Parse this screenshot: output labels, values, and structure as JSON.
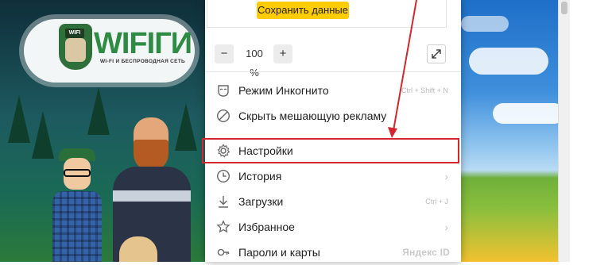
{
  "site_banner": {
    "logo_text": "WIFIГИ",
    "logo_badge": "WIFI",
    "logo_subtitle": "WI-FI И БЕСПРОВОДНАЯ СЕТЬ"
  },
  "menu": {
    "save_button_label": "Сохранить данные",
    "zoom": {
      "minus_label": "−",
      "value": "100 %",
      "plus_label": "+"
    },
    "items": [
      {
        "label": "Режим Инкогнито",
        "shortcut": "Ctrl + Shift + N",
        "icon": "incognito-mask-icon"
      },
      {
        "label": "Скрыть мешающую рекламу",
        "icon": "block-icon"
      },
      {
        "label": "Настройки",
        "icon": "gear-icon"
      },
      {
        "label": "История",
        "chevron": "›",
        "icon": "clock-icon"
      },
      {
        "label": "Загрузки",
        "shortcut": "Ctrl + J",
        "icon": "download-icon"
      },
      {
        "label": "Избранное",
        "chevron": "›",
        "icon": "star-icon"
      },
      {
        "label": "Пароли и карты",
        "brand": "Яндекс ID",
        "icon": "key-icon"
      }
    ]
  },
  "colors": {
    "accent_yellow": "#ffcc00",
    "highlight_red": "#d3262e"
  }
}
